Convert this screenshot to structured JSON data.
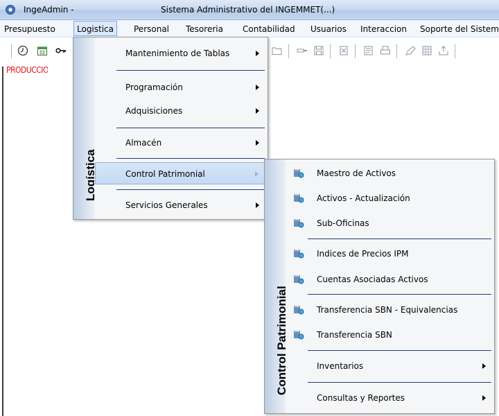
{
  "window": {
    "app_name": "IngeAdmin -",
    "title": "Sistema Administrativo del INGEMMET(...)"
  },
  "menubar": {
    "items": [
      {
        "label": "Presupuesto"
      },
      {
        "label": "Logistica"
      },
      {
        "label": "Personal"
      },
      {
        "label": "Tesoreria"
      },
      {
        "label": "Contabilidad"
      },
      {
        "label": "Usuarios"
      },
      {
        "label": "Interaccion"
      },
      {
        "label": "Soporte del Sistem"
      }
    ]
  },
  "status": {
    "environment_label": "PRODUCCION"
  },
  "logistica_menu": {
    "band_title": "Logística",
    "items": [
      {
        "label": "Mantenimiento de Tablas"
      },
      {
        "label": "Programación"
      },
      {
        "label": "Adquisiciones"
      },
      {
        "label": "Almacén"
      },
      {
        "label": "Control Patrimonial"
      },
      {
        "label": "Servicios Generales"
      }
    ]
  },
  "control_patrimonial_menu": {
    "band_title": "Control Patrimonial",
    "items": [
      {
        "label": "Maestro de Activos"
      },
      {
        "label": "Activos - Actualización"
      },
      {
        "label": "Sub-Oficinas"
      },
      {
        "label": "Indices de Precios IPM"
      },
      {
        "label": "Cuentas Asociadas Activos"
      },
      {
        "label": "Transferencia SBN - Equivalencias"
      },
      {
        "label": "Transferencia SBN"
      },
      {
        "label": "Inventarios"
      },
      {
        "label": "Consultas y Reportes"
      }
    ]
  },
  "colors": {
    "highlight": "#c4daf4",
    "produccion_text": "#e0151b",
    "separator": "#1f3e7a"
  }
}
